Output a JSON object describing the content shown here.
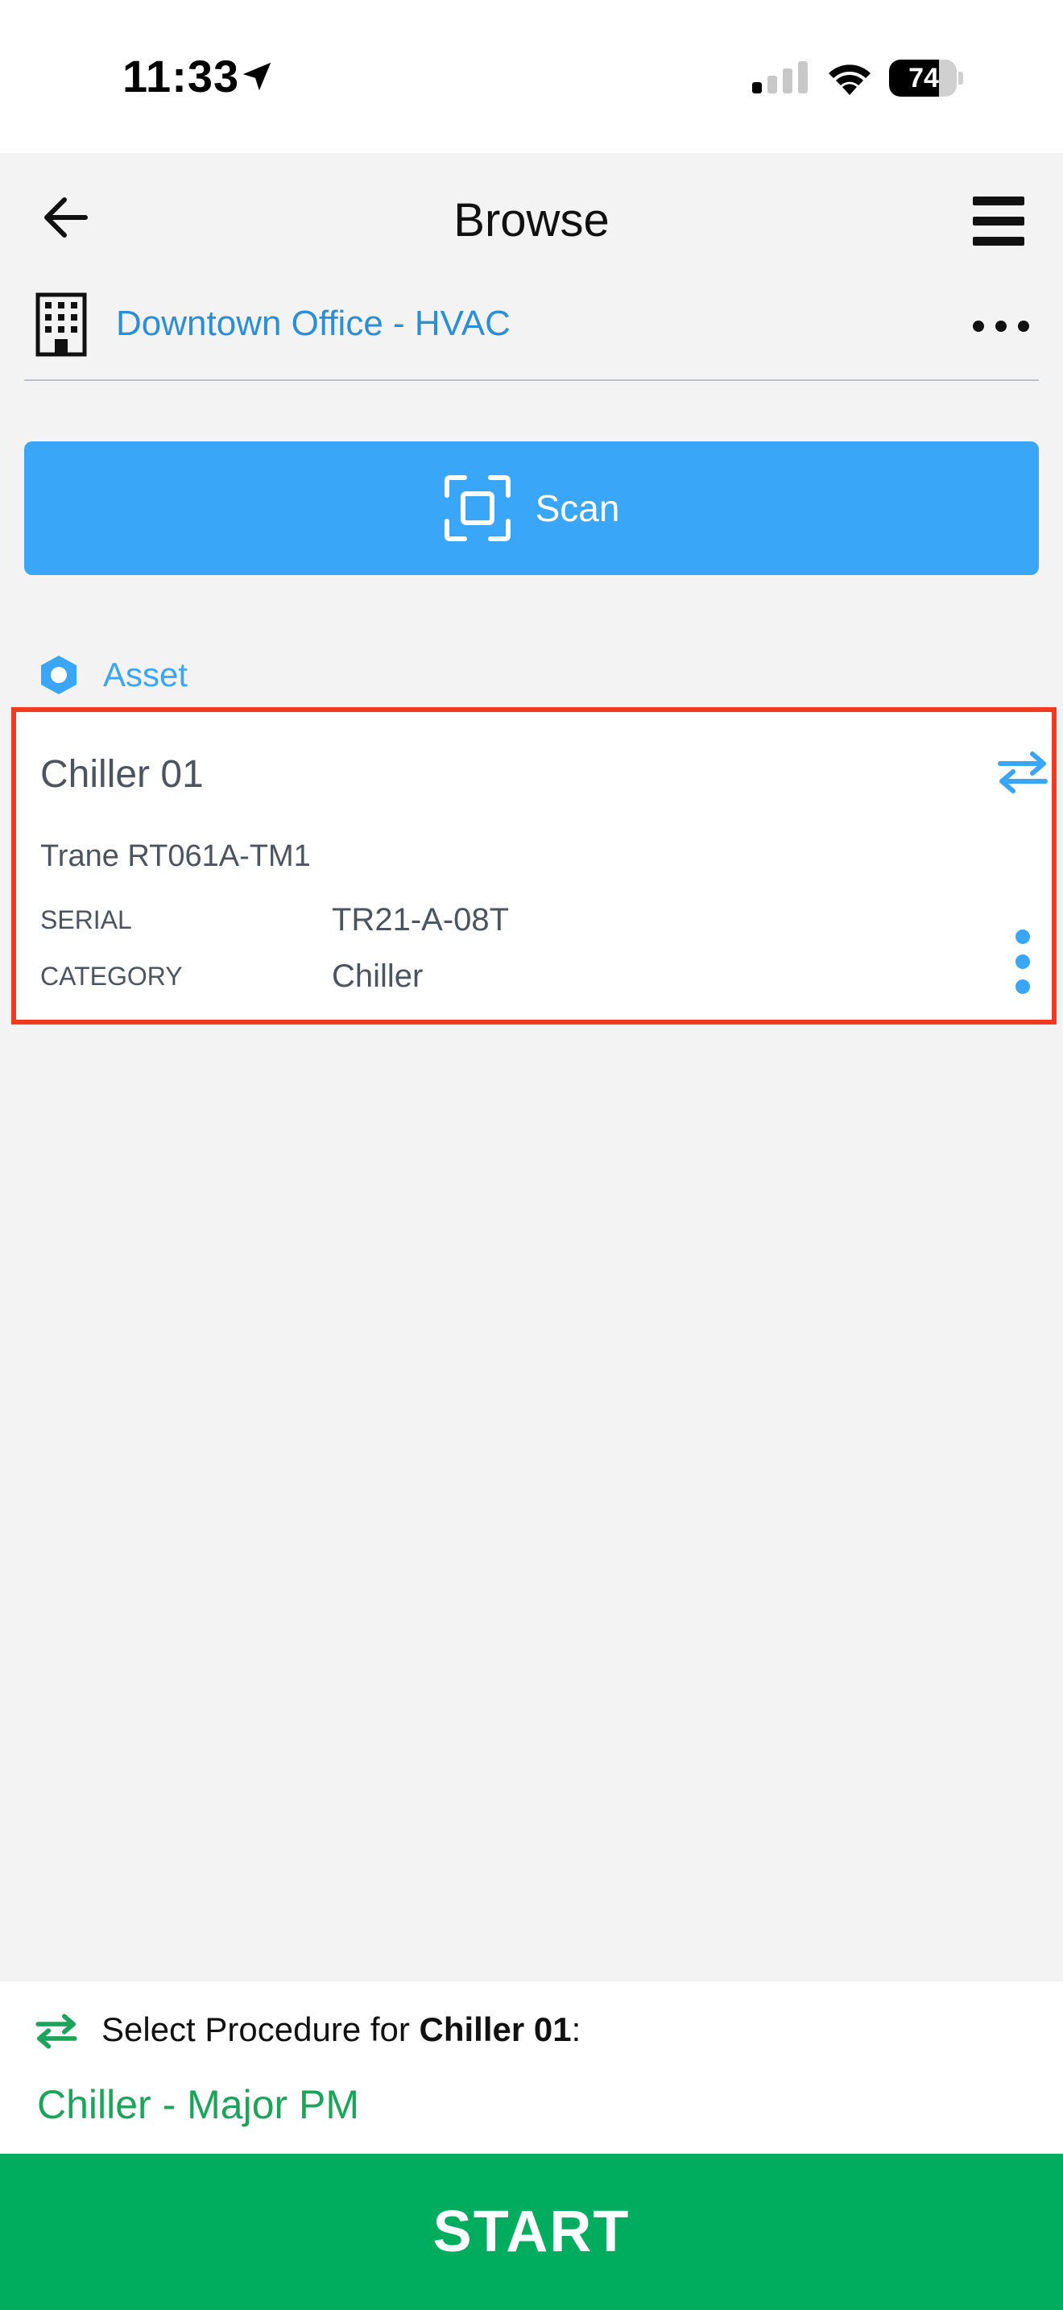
{
  "status_bar": {
    "time": "11:33",
    "battery_percent": 74,
    "battery_label": "74"
  },
  "nav": {
    "title": "Browse",
    "back_icon": "arrow-left-icon",
    "menu_icon": "hamburger-icon"
  },
  "location": {
    "icon": "building-icon",
    "label": "Downtown Office - HVAC",
    "more_icon": "more-horizontal-icon"
  },
  "scan": {
    "label": "Scan",
    "icon": "scan-frame-icon"
  },
  "section": {
    "icon": "hexagon-icon",
    "label": "Asset"
  },
  "asset": {
    "name": "Chiller 01",
    "model": "Trane RT061A-TM1",
    "fields": [
      {
        "label": "SERIAL",
        "value": "TR21-A-08T"
      },
      {
        "label": "CATEGORY",
        "value": "Chiller"
      }
    ],
    "swap_icon": "swap-arrows-icon",
    "more_icon": "more-vertical-icon"
  },
  "procedure": {
    "prompt_prefix": "Select Procedure for ",
    "prompt_asset": "Chiller 01",
    "prompt_suffix": ":",
    "selected": "Chiller - Major PM"
  },
  "start": {
    "label": "START"
  },
  "colors": {
    "accent_blue": "#3aa6f7",
    "link_blue": "#2a8fd6",
    "start_green": "#00ad5f",
    "procedure_green": "#1aa55a",
    "highlight_red": "#f13a1f"
  }
}
